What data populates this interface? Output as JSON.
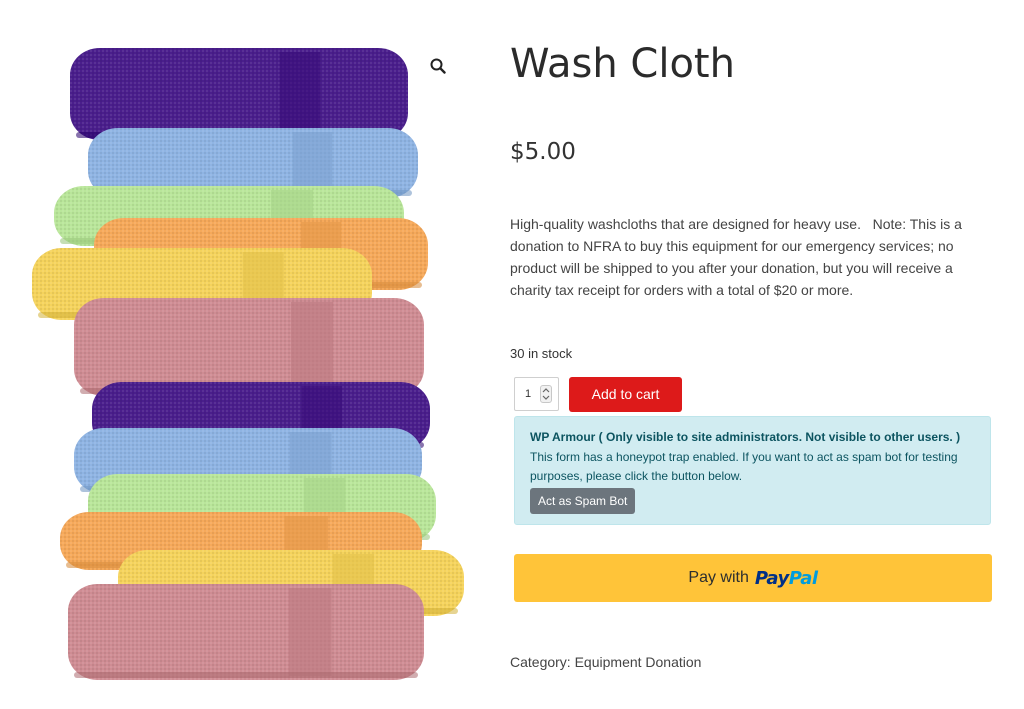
{
  "product": {
    "title": "Wash Cloth",
    "price": "$5.00",
    "description": "High-quality washcloths that are designed for heavy use.   Note: This is a donation to NFRA to buy this equipment for our emergency services; no product will be shipped to you after your donation, but you will receive a charity tax receipt for orders with a total of $20 or more.",
    "stock": "30 in stock",
    "quantity": "1",
    "add_to_cart_label": "Add to cart",
    "category_label": "Category:",
    "category_value": "Equipment Donation"
  },
  "gallery": {
    "zoom_icon": "magnifier-icon",
    "towel_colors": [
      "#4a1e8c",
      "#8fb4e3",
      "#b9e69a",
      "#f6a95a",
      "#f5d35c",
      "#cf8c93"
    ]
  },
  "wp_armour": {
    "heading": "WP Armour ( Only visible to site administrators. Not visible to other users. )",
    "text": "This form has a honeypot trap enabled. If you want to act as spam bot for testing purposes, please click the button below.",
    "button_label": "Act as Spam Bot"
  },
  "paypal": {
    "pay_with_label": "Pay with",
    "logo_pay": "Pay",
    "logo_pal": "Pal",
    "button_color": "#ffc439"
  },
  "colors": {
    "add_to_cart": "#dd1a1a",
    "notice_bg": "#d1ecf1",
    "notice_text": "#0c5460",
    "spam_button": "#6c757d"
  }
}
